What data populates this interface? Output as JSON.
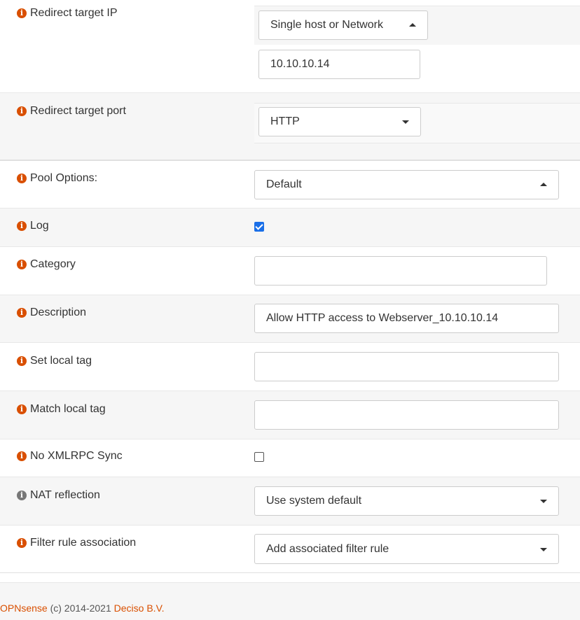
{
  "fields": {
    "redirect_ip": {
      "label": "Redirect target IP",
      "type_select": "Single host or Network",
      "address": "10.10.10.14"
    },
    "redirect_port": {
      "label": "Redirect target port",
      "value": "HTTP"
    },
    "pool_options": {
      "label": "Pool Options:",
      "value": "Default"
    },
    "log": {
      "label": "Log",
      "checked": true
    },
    "category": {
      "label": "Category",
      "value": ""
    },
    "description": {
      "label": "Description",
      "value": "Allow HTTP access to Webserver_10.10.10.14"
    },
    "set_local_tag": {
      "label": "Set local tag",
      "value": ""
    },
    "match_local_tag": {
      "label": "Match local tag",
      "value": ""
    },
    "no_xmlrpc_sync": {
      "label": "No XMLRPC Sync",
      "checked": false
    },
    "nat_reflection": {
      "label": "NAT reflection",
      "value": "Use system default"
    },
    "filter_rule_association": {
      "label": "Filter rule association",
      "value": "Add associated filter rule"
    }
  },
  "footer": {
    "brand": "OPNsense",
    "copyright": "(c) 2014-2021",
    "company": "Deciso B.V."
  },
  "colors": {
    "accent": "#d94f00",
    "info_icon_grey": "#777777",
    "checkbox_checked": "#1a6fe8"
  },
  "icons": {
    "info": "info-circle-icon",
    "select_open": "caret-up-icon",
    "select_closed": "caret-down-icon"
  }
}
